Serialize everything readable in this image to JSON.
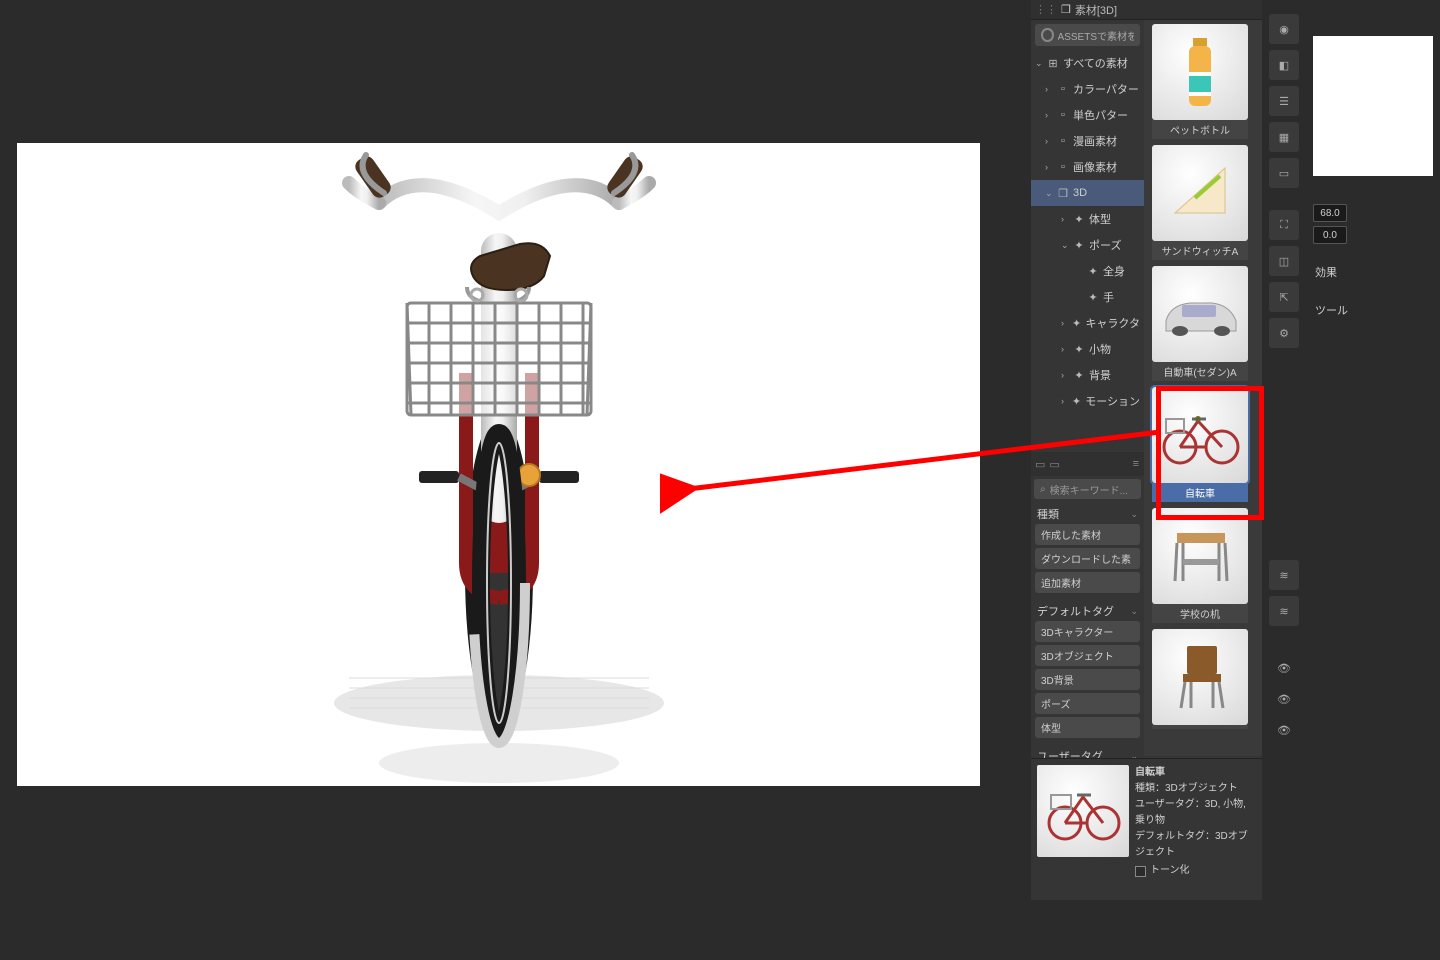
{
  "panel": {
    "title": "素材[3D]",
    "search_label": "ASSETSで素材をさ"
  },
  "tree": {
    "root": "すべての素材",
    "items": [
      {
        "label": "カラーパター",
        "icon": "grid"
      },
      {
        "label": "単色パター",
        "icon": "x"
      },
      {
        "label": "漫画素材",
        "icon": "panel"
      },
      {
        "label": "画像素材",
        "icon": "img"
      }
    ],
    "threeD": "3D",
    "threeD_children": [
      {
        "label": "体型",
        "icon": "body"
      },
      {
        "label": "ポーズ",
        "icon": "pose",
        "expandable": true
      },
      {
        "label": "全身",
        "icon": "pose",
        "indent": true
      },
      {
        "label": "手",
        "icon": "hand",
        "indent": true
      },
      {
        "label": "キャラクタ",
        "icon": "char"
      },
      {
        "label": "小物",
        "icon": "prop"
      },
      {
        "label": "背景",
        "icon": "bg"
      },
      {
        "label": "モーション",
        "icon": "motion"
      }
    ]
  },
  "thumbs": [
    {
      "label": "ペットボトル",
      "kind": "bottle"
    },
    {
      "label": "サンドウィッチA",
      "kind": "sandwich"
    },
    {
      "label": "自動車(セダン)A",
      "kind": "car"
    },
    {
      "label": "自転車",
      "kind": "bike",
      "selected": true
    },
    {
      "label": "学校の机",
      "kind": "desk"
    },
    {
      "label": "",
      "kind": "chair"
    }
  ],
  "tags": {
    "search_placeholder": "検索キーワード...",
    "section1_title": "種類",
    "section1": [
      "作成した素材",
      "ダウンロードした素",
      "追加素材"
    ],
    "section2_title": "デフォルトタグ",
    "section2": [
      "3Dキャラクター",
      "3Dオブジェクト",
      "3D背景",
      "ポーズ",
      "体型"
    ],
    "section3_title": "ユーザータグ"
  },
  "info": {
    "name": "自転車",
    "type_label": "種類：3Dオブジェクト",
    "user_tag_label": "ユーザータグ：3D, 小物, 乗り物",
    "default_tag_label": "デフォルトタグ：3Dオブジェクト",
    "tone_label": "トーン化"
  },
  "right": {
    "val1": "68.0",
    "val2": "0.0",
    "effect_label": "効果",
    "tool_label": "ツール"
  }
}
